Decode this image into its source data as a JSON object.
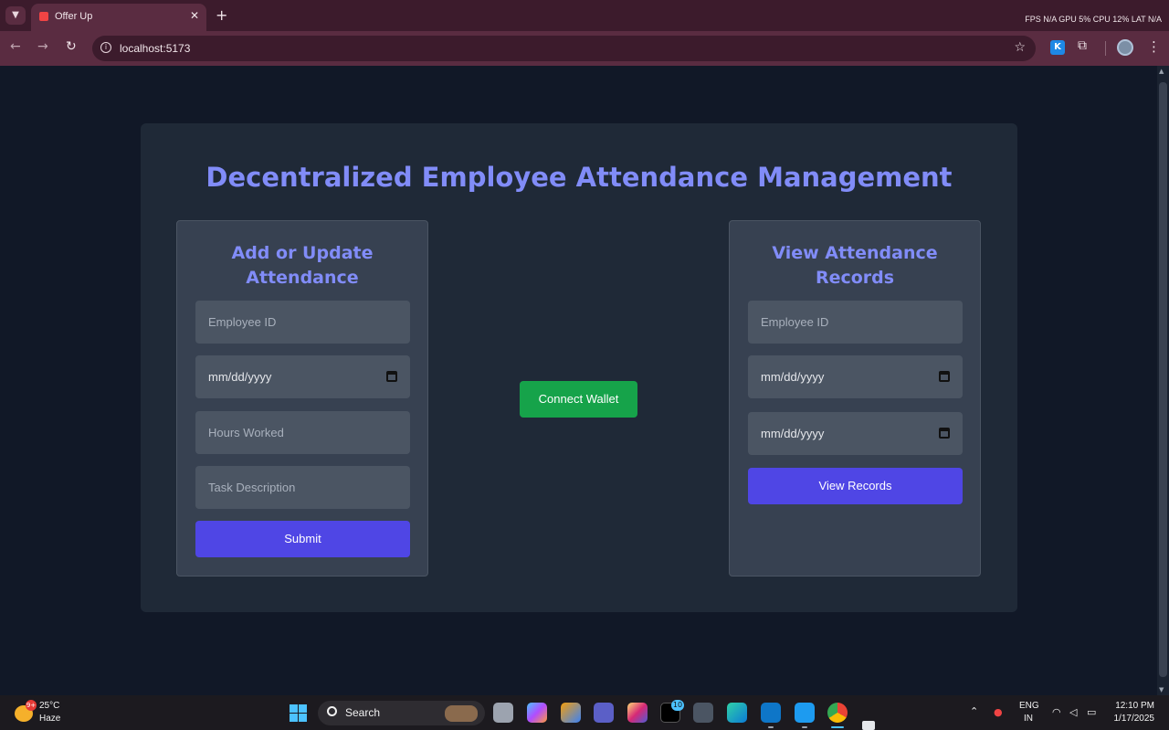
{
  "browser": {
    "tab_title": "Offer Up",
    "url": "localhost:5173",
    "perf_overlay": "FPS N/A GPU 5% CPU 12% LAT N/A"
  },
  "page": {
    "title": "Decentralized Employee Attendance Management",
    "add_panel": {
      "title": "Add or Update Attendance",
      "employee_id_placeholder": "Employee ID",
      "date_placeholder": "mm/dd/yyyy",
      "hours_placeholder": "Hours Worked",
      "task_placeholder": "Task Description",
      "submit_label": "Submit"
    },
    "connect_wallet_label": "Connect Wallet",
    "view_panel": {
      "title": "View Attendance Records",
      "employee_id_placeholder": "Employee ID",
      "start_date_placeholder": "mm/dd/yyyy",
      "end_date_placeholder": "mm/dd/yyyy",
      "view_label": "View Records"
    }
  },
  "taskbar": {
    "weather_temp": "25°C",
    "weather_desc": "Haze",
    "weather_badge": "9+",
    "search_label": "Search",
    "threads_badge": "10",
    "lang_line1": "ENG",
    "lang_line2": "IN",
    "time": "12:10 PM",
    "date": "1/17/2025"
  },
  "colors": {
    "page_bg": "#111827",
    "card_bg": "#1f2937",
    "panel_bg": "#374151",
    "input_bg": "#4b5563",
    "accent_title": "#818cf8",
    "primary_button": "#4f46e5",
    "wallet_button": "#16a34a"
  }
}
